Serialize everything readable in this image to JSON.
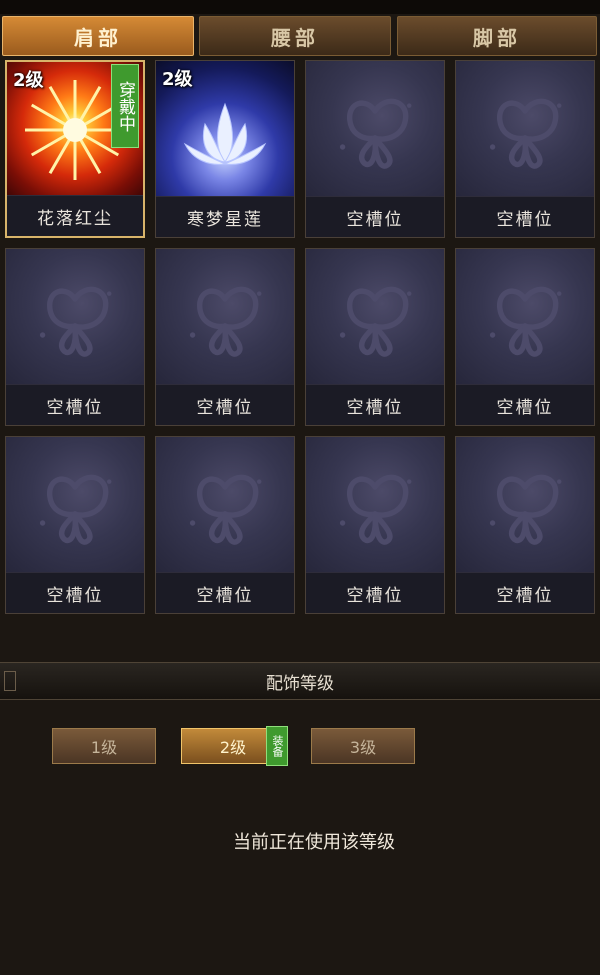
{
  "tabs": [
    {
      "label": "肩部",
      "active": true
    },
    {
      "label": "腰部",
      "active": false
    },
    {
      "label": "脚部",
      "active": false
    }
  ],
  "slots": [
    {
      "name": "花落红尘",
      "level": "2级",
      "worn": "穿戴中",
      "art": "fire"
    },
    {
      "name": "寒梦星莲",
      "level": "2级",
      "art": "lotus"
    },
    {
      "name": "空槽位"
    },
    {
      "name": "空槽位"
    },
    {
      "name": "空槽位"
    },
    {
      "name": "空槽位"
    },
    {
      "name": "空槽位"
    },
    {
      "name": "空槽位"
    },
    {
      "name": "空槽位"
    },
    {
      "name": "空槽位"
    },
    {
      "name": "空槽位"
    },
    {
      "name": "空槽位"
    }
  ],
  "section": {
    "title": "配饰等级"
  },
  "levels": [
    {
      "label": "1级",
      "active": false
    },
    {
      "label": "2级",
      "active": true
    },
    {
      "label": "3级",
      "active": false
    }
  ],
  "equip_tag": "装备",
  "status_text": "当前正在使用该等级",
  "icons": {
    "empty_slot": "butterfly-icon",
    "sparkle": "sparkle-icon"
  },
  "colors": {
    "accent": "#d58a35",
    "worn_badge": "#3f9a2e",
    "selected_border": "#d8b46a"
  }
}
